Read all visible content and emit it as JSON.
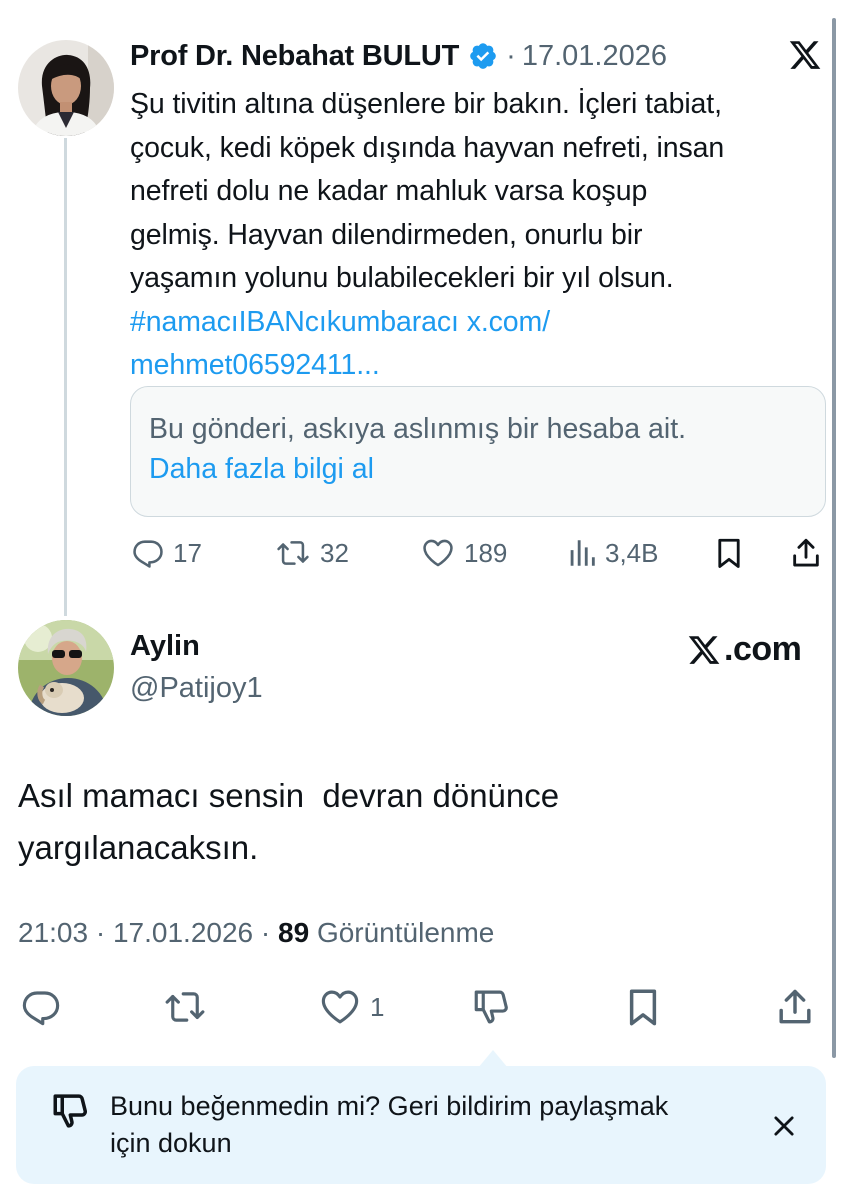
{
  "quoted": {
    "author_name": "Prof Dr. Nebahat BULUT",
    "separator": "·",
    "date": "17.01.2026",
    "text_lines": [
      "Şu tivitin altına düşenlere bir bakın. İçleri tabiat,",
      "çocuk, kedi köpek dışında hayvan nefreti, insan",
      "nefreti dolu ne kadar mahluk varsa koşup",
      "gelmiş. Hayvan dilendirmeden, onurlu bir",
      "yaşamın yolunu bulabilecekleri bir yıl olsun."
    ],
    "hashtag": "#namacıIBANcıkumbaracı",
    "link_part1": "x.com/",
    "link_part2": "mehmet06592411...",
    "suspended_notice": "Bu gönderi, askıya aslınmış bir hesaba ait.",
    "learn_more": "Daha fazla bilgi al",
    "stats": {
      "replies": "17",
      "reposts": "32",
      "likes": "189",
      "views": "3,4B"
    }
  },
  "reply": {
    "author_name": "Aylin",
    "handle": "@Patijoy1",
    "brand": ".com",
    "text_lines": [
      "Asıl mamacı sensin  devran dönünce",
      "yargılanacaksın."
    ],
    "time": "21:03",
    "date": "17.01.2026",
    "separator": "·",
    "views_count": "89",
    "views_label": "Görüntülenme",
    "likes": "1"
  },
  "feedback": {
    "line1": "Bunu beğenmedin mi? Geri bildirim paylaşmak",
    "line2": "için dokun"
  },
  "colors": {
    "accent": "#1d9bf0",
    "secondary_text": "#536471",
    "banner_bg": "#e8f5fd",
    "border": "#cfd9de"
  },
  "icons": [
    "verified-badge-icon",
    "x-logo-icon",
    "reply-icon",
    "repost-icon",
    "like-icon",
    "views-icon",
    "bookmark-icon",
    "share-icon",
    "dislike-icon",
    "close-icon"
  ]
}
